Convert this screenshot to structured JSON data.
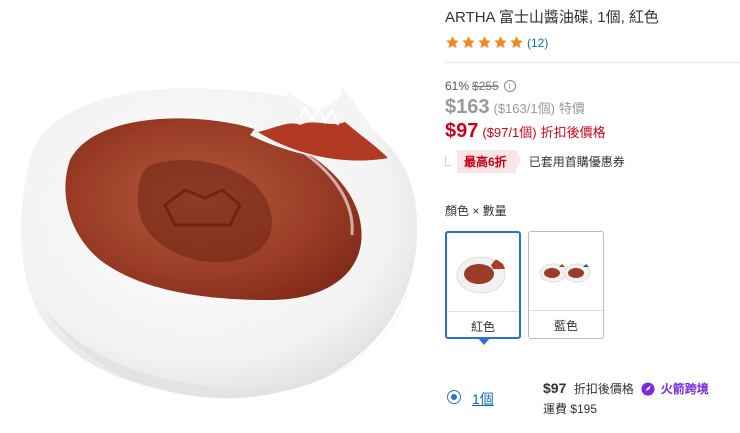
{
  "product": {
    "title": "ARTHA 富士山醬油碟, 1個, 紅色",
    "rating": 5,
    "review_count": "(12)"
  },
  "pricing": {
    "discount_percent": "61%",
    "original_price": "$255",
    "info_icon": "i",
    "price": "$163",
    "unit_price": "($163/1個)",
    "price_tag": "特價",
    "discounted_price": "$97",
    "discounted_unit_price": "($97/1個)",
    "discounted_tag": "折扣後價格"
  },
  "coupon": {
    "badge": "最高6折",
    "text": "已套用首購優惠券"
  },
  "variants": {
    "label": "顏色 × 數量",
    "options": [
      {
        "label": "紅色",
        "selected": true
      },
      {
        "label": "藍色",
        "selected": false
      }
    ]
  },
  "quantity_option": {
    "label": "1個",
    "price": "$97",
    "price_tag": "折扣後價格",
    "badge": "火箭跨境",
    "shipping": "運費 $195"
  },
  "colors": {
    "accent": "#2b6fd6",
    "sale_red": "#d0021b",
    "star": "#f08a24",
    "link": "#0f6db8"
  }
}
